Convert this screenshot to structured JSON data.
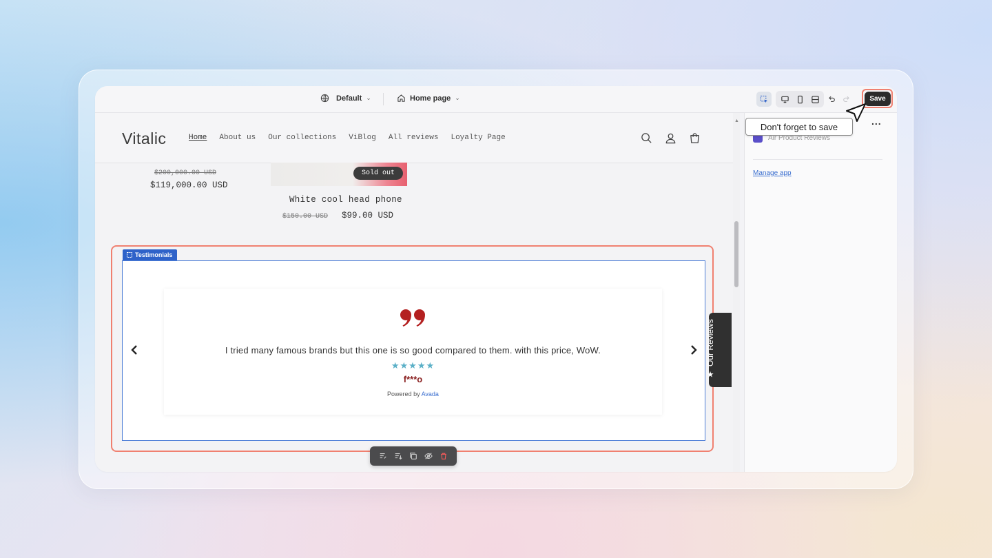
{
  "topbar": {
    "theme_label": "Default",
    "page_label": "Home page",
    "save_label": "Save",
    "icons": [
      "globe-icon",
      "home-icon",
      "inspector-icon",
      "desktop-icon",
      "mobile-icon",
      "fullscreen-icon",
      "undo-icon",
      "redo-icon"
    ]
  },
  "store": {
    "logo": "Vitalic",
    "nav": [
      "Home",
      "About us",
      "Our collections",
      "ViBlog",
      "All reviews",
      "Loyalty Page"
    ],
    "product1": {
      "old_price": "$200,000.00 USD",
      "price": "$119,000.00 USD"
    },
    "product2": {
      "badge": "Sold out",
      "title": "White cool head phone",
      "old_price": "$150.00 USD",
      "price": "$99.00 USD"
    }
  },
  "section": {
    "tag": "Testimonials",
    "review_text": "I tried many famous brands but this one is so good compared to them. with this price, WoW.",
    "stars": "★★★★★",
    "rating": 5,
    "author": "f***o",
    "powered_prefix": "Powered by ",
    "powered_brand": "Avada",
    "reviews_tab": "Our Reviews"
  },
  "panel": {
    "app_name": "Air Product Reviews",
    "manage_link": "Manage app",
    "menu": "..."
  },
  "tooltip": "Don't forget to save",
  "colors": {
    "accent_blue": "#2e62c9",
    "highlight_red": "#f08070",
    "star_color": "#5bb0c7",
    "author_color": "#8a2020",
    "quote_color": "#b42020"
  }
}
